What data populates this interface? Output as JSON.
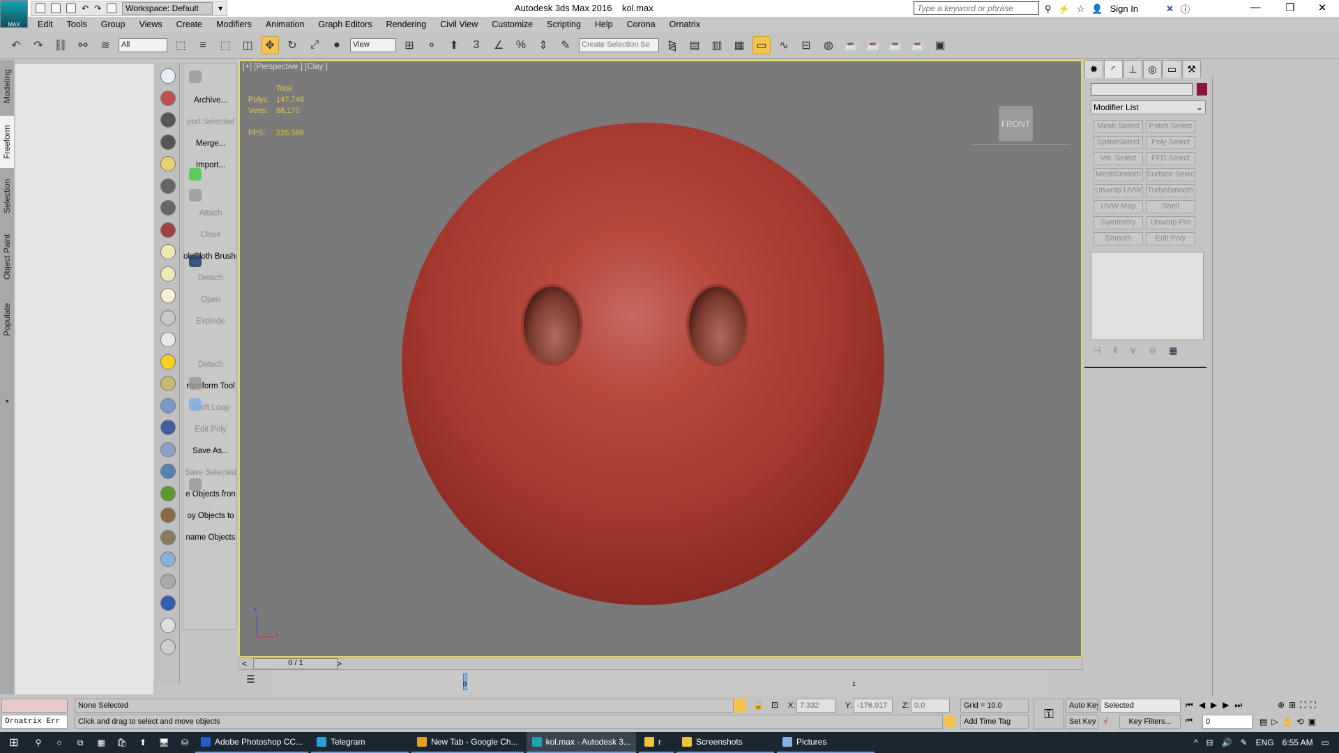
{
  "app": {
    "title": "Autodesk 3ds Max 2016",
    "file": "kol.max",
    "logo": "MAX",
    "workspace": "Workspace: Default",
    "search_placeholder": "Type a keyword or phrase",
    "sign_in": "Sign In"
  },
  "menu": [
    "Edit",
    "Tools",
    "Group",
    "Views",
    "Create",
    "Modifiers",
    "Animation",
    "Graph Editors",
    "Rendering",
    "Civil View",
    "Customize",
    "Scripting",
    "Help",
    "Corona",
    "Ornatrix"
  ],
  "toolbar": {
    "filter": "All",
    "ref_coord": "View",
    "selection_set_placeholder": "Create Selection Se",
    "snaps": [
      "3",
      "%"
    ]
  },
  "ribbon_tabs": [
    "Modeling",
    "Freeform",
    "Selection",
    "Object Paint",
    "Populate"
  ],
  "ribbon_active": "Freeform",
  "commands": [
    {
      "label": "Archive...",
      "enabled": true
    },
    {
      "label": "port Selected",
      "enabled": false
    },
    {
      "label": "Merge...",
      "enabled": true
    },
    {
      "label": "Import...",
      "enabled": true
    },
    {
      "label": "Attach",
      "enabled": false
    },
    {
      "label": "Close",
      "enabled": false
    },
    {
      "label": "olyCloth Brushe",
      "enabled": true
    },
    {
      "label": "Detach",
      "enabled": false
    },
    {
      "label": "Open",
      "enabled": false
    },
    {
      "label": "Explode",
      "enabled": false
    },
    {
      "label": "Detach",
      "enabled": false
    },
    {
      "label": "ransform Tool",
      "enabled": true
    },
    {
      "label": "Swift Loop",
      "enabled": false
    },
    {
      "label": "Edit Poly",
      "enabled": false
    },
    {
      "label": "Save As...",
      "enabled": true
    },
    {
      "label": "Save Selected",
      "enabled": false
    },
    {
      "label": "e Objects fron",
      "enabled": true
    },
    {
      "label": "oy Objects to",
      "enabled": true
    },
    {
      "label": "name Objects",
      "enabled": true
    }
  ],
  "viewport": {
    "label": "[+] [Perspective ] [Clay ]",
    "stats": {
      "header": "Total",
      "polys_label": "Polys:",
      "polys": "147,748",
      "verts_label": "Verts:",
      "verts": "88,170",
      "fps_label": "FPS:",
      "fps": "225.586"
    },
    "viewcube": "FRONT",
    "axis": {
      "z": "z",
      "x": "x"
    },
    "object_color": "#b0463b",
    "border_color": "#e3d86a"
  },
  "command_panel": {
    "name_color": "#8b1538",
    "modifier_list": "Modifier List",
    "modifiers": [
      "Mesh Select",
      "Patch Select",
      "SplineSelect",
      "Poly Select",
      "Vol. Select",
      "FFD Select",
      "MeshSmooth",
      "Surface Select",
      "Unwrap UVW",
      "TurboSmooth",
      "UVW Map",
      "Shell",
      "Symmetry",
      "Unwrap Pro",
      "Smooth",
      "Edit Poly"
    ]
  },
  "timeline": {
    "frame": "0 / 1",
    "prev": "<",
    "next": ">",
    "tick0": "0",
    "tick1": "1"
  },
  "status": {
    "maxscript": "Ornatrix Err",
    "selection": "None Selected",
    "prompt": "Click and drag to select and move objects",
    "x_label": "X:",
    "x": "7.332",
    "y_label": "Y:",
    "y": "-176.917",
    "z_label": "Z:",
    "z": "0.0",
    "grid": "Grid = 10.0",
    "add_time_tag": "Add Time Tag",
    "auto_key": "Auto Key",
    "set_key": "Set Key",
    "key_mode": "Selected",
    "key_filters": "Key Filters...",
    "current_frame": "0"
  },
  "taskbar": {
    "items": [
      {
        "label": "Adobe Photoshop CC...",
        "color": "#2b5cc4"
      },
      {
        "label": "Telegram",
        "color": "#2aa0d8"
      },
      {
        "label": "New Tab - Google Ch...",
        "color": "#e0a020"
      },
      {
        "label": "kol.max - Autodesk 3...",
        "color": "#1aa3b3",
        "active": true
      },
      {
        "label": "r",
        "color": "#f0c040"
      },
      {
        "label": "Screenshots",
        "color": "#f0c040"
      },
      {
        "label": "Pictures",
        "color": "#8ab0e0"
      }
    ],
    "lang": "ENG",
    "time": "6:55 AM"
  }
}
